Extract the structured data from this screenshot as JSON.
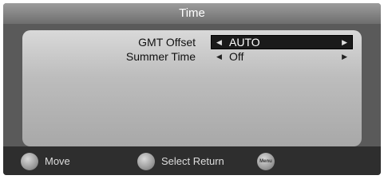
{
  "window": {
    "title": "Time"
  },
  "settings": [
    {
      "label": "GMT Offset",
      "value": "AUTO",
      "selected": true
    },
    {
      "label": "Summer Time",
      "value": "Off",
      "selected": false
    }
  ],
  "arrows": {
    "left": "◀",
    "right": "▶"
  },
  "footer": {
    "move_label": "Move",
    "select_return_label": "Select Return",
    "menu_button_text": "Menu"
  },
  "icons": {
    "move": "dpad-icon",
    "select": "ok-button-icon",
    "menu": "menu-button-icon"
  },
  "colors": {
    "background": "#5a5a5a",
    "panel": "#bdbdbd",
    "selection": "#1a1a1a",
    "footer": "#2e2e2e"
  }
}
